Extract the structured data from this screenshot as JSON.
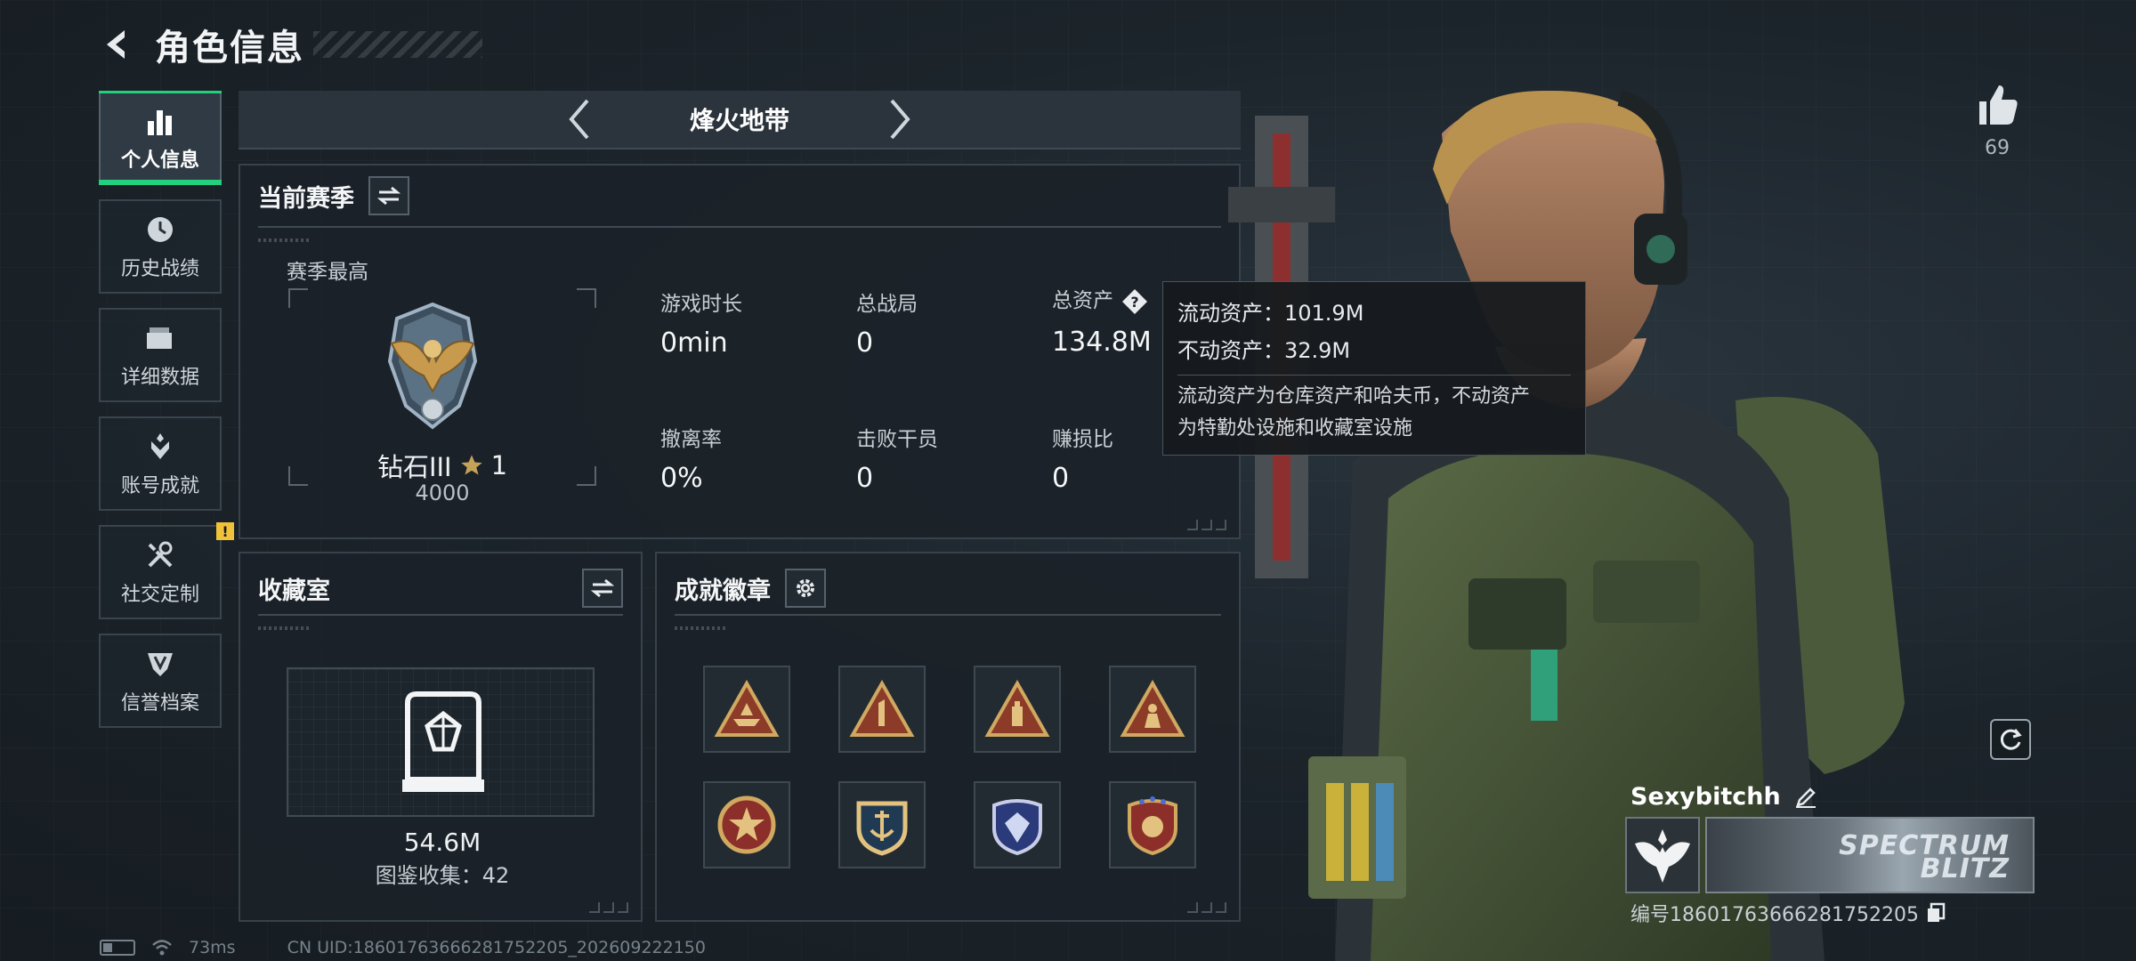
{
  "header": {
    "title": "角色信息"
  },
  "sidebar": {
    "items": [
      {
        "label": "个人信息",
        "icon": "bar-chart-icon",
        "active": true
      },
      {
        "label": "历史战绩",
        "icon": "history-clock-icon"
      },
      {
        "label": "详细数据",
        "icon": "folder-icon"
      },
      {
        "label": "账号成就",
        "icon": "achievement-icon"
      },
      {
        "label": "社交定制",
        "icon": "tools-icon",
        "badge": "!"
      },
      {
        "label": "信誉档案",
        "icon": "shield-icon"
      }
    ]
  },
  "mode_bar": {
    "title": "烽火地带"
  },
  "season": {
    "title": "当前赛季",
    "best_label": "赛季最高",
    "rank_name": "钻石III",
    "rank_stars": "1",
    "rank_score": "4000",
    "stats": [
      {
        "label": "游戏时长",
        "value": "0min"
      },
      {
        "label": "总战局",
        "value": "0"
      },
      {
        "label": "总资产",
        "value": "134.8M"
      },
      {
        "label": "撤离率",
        "value": "0%"
      },
      {
        "label": "击败干员",
        "value": "0"
      },
      {
        "label": "赚损比",
        "value": "0"
      }
    ]
  },
  "tooltip": {
    "liquid": "流动资产：101.9M",
    "fixed": "不动资产：32.9M",
    "note_line1": "流动资产为仓库资产和哈夫币，不动资产",
    "note_line2": "为特勤处设施和收藏室设施"
  },
  "collection": {
    "title": "收藏室",
    "value": "54.6M",
    "count": "图鉴收集：42"
  },
  "badges": {
    "title": "成就徽章",
    "items": [
      "triangle-badge-ship",
      "triangle-badge-one",
      "triangle-badge-tower",
      "triangle-badge-soldier",
      "round-badge-star",
      "crest-badge-anchor",
      "shield-badge-gem",
      "shield-badge-stars"
    ]
  },
  "likes": {
    "count": "69"
  },
  "player": {
    "name": "Sexybitchh",
    "banner_text_1": "SPECTRUM",
    "banner_text_2": "BLITZ",
    "uid": "编号1860176366628175220​5"
  },
  "footer": {
    "ping": "73ms",
    "uid": "CN UID:18601763666281752205_202609222150"
  },
  "colors": {
    "accent": "#22d07e",
    "warn": "#f0c23a",
    "bronze": "#b88a4a"
  }
}
